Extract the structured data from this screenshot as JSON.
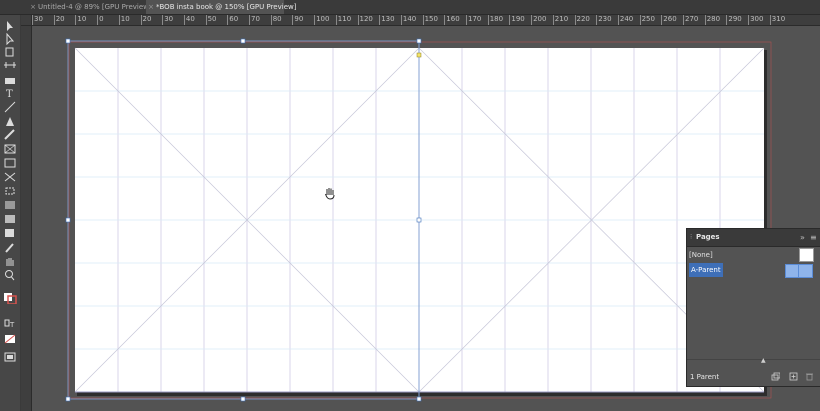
{
  "tabs": [
    {
      "label": "Untitled-4 @ 89% [GPU Preview]",
      "active": false
    },
    {
      "label": "*BOB insta book @ 150% [GPU Preview]",
      "active": true
    }
  ],
  "ruler": {
    "ticks": [
      "30",
      "20",
      "10",
      "0",
      "10",
      "20",
      "30",
      "40",
      "50",
      "60",
      "70",
      "80",
      "90",
      "100",
      "110",
      "120",
      "130",
      "140",
      "150",
      "160",
      "170",
      "180",
      "190",
      "200",
      "210",
      "220",
      "230",
      "240",
      "250",
      "260",
      "270",
      "280",
      "290",
      "300",
      "310"
    ]
  },
  "tools": [
    "selection-icon",
    "direct-selection-icon",
    "page-tool-icon",
    "gap-tool-icon",
    "content-collector-icon",
    "type-icon",
    "line-icon",
    "pen-icon",
    "pencil-icon",
    "rectangle-frame-icon",
    "rectangle-icon",
    "scissors-icon",
    "free-transform-icon",
    "gradient-swatch-icon",
    "gradient-feather-icon",
    "note-icon",
    "eyedropper-icon",
    "hand-icon",
    "zoom-icon",
    "fill-stroke-icon",
    "formatting-icon",
    "apply-color-icon",
    "screen-mode-icon"
  ],
  "pages_panel": {
    "title": "Pages",
    "none_label": "[None]",
    "parent_label": "A-Parent",
    "count_label": "1 Parent"
  },
  "colors": {
    "app_bg": "#535353",
    "page": "#ffffff",
    "margin_guide": "#b7a6d6",
    "grid_line": "#d4e6f7",
    "bleed": "#d9534f",
    "selection": "#3e6fb8"
  }
}
